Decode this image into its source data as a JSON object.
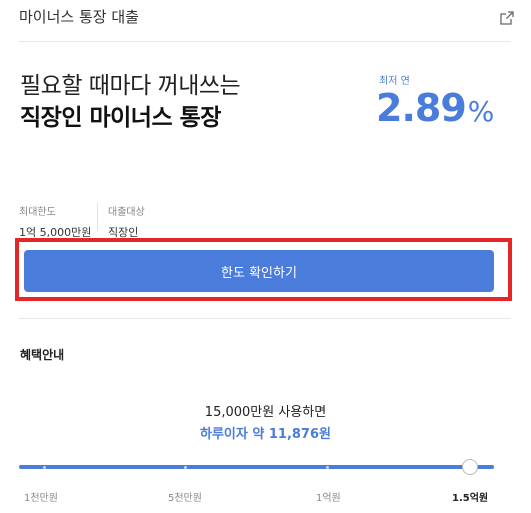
{
  "header": {
    "title": "마이너스 통장 대출",
    "share_icon": "external-share-icon"
  },
  "hero": {
    "line1": "필요할 때마다 꺼내쓰는",
    "line2": "직장인 마이너스 통장",
    "rate_label": "최저 연",
    "rate_value": "2.89",
    "rate_unit": "%"
  },
  "info": [
    {
      "label": "최대한도",
      "value": "1억 5,000만원"
    },
    {
      "label": "대출대상",
      "value": "직장인"
    }
  ],
  "cta": {
    "label": "한도 확인하기"
  },
  "benefit": {
    "title": "혜택안내",
    "usage": "15,000만원 사용하면",
    "interest": "하루이자 약 11,876원"
  },
  "slider": {
    "ticks": [
      "1천만원",
      "5천만원",
      "1억원",
      "1.5억원"
    ],
    "selected_index": 3
  },
  "colors": {
    "accent": "#4a7cdc",
    "highlight": "#e32626"
  }
}
